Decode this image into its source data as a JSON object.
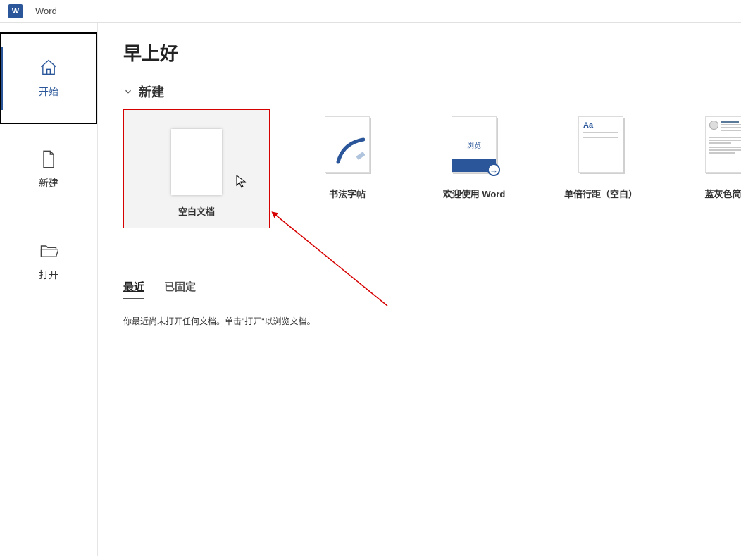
{
  "app_name": "Word",
  "greeting": "早上好",
  "sidebar": {
    "items": [
      {
        "label": "开始"
      },
      {
        "label": "新建"
      },
      {
        "label": "打开"
      }
    ]
  },
  "section_new": "新建",
  "templates": [
    {
      "label": "空白文档"
    },
    {
      "label": "书法字帖"
    },
    {
      "label": "欢迎使用 Word",
      "browse": "浏览"
    },
    {
      "label": "单倍行距（空白）",
      "aa": "Aa"
    },
    {
      "label": "蓝灰色简历"
    }
  ],
  "tabs": [
    {
      "label": "最近"
    },
    {
      "label": "已固定"
    }
  ],
  "empty_message": "你最近尚未打开任何文档。单击\"打开\"以浏览文档。"
}
